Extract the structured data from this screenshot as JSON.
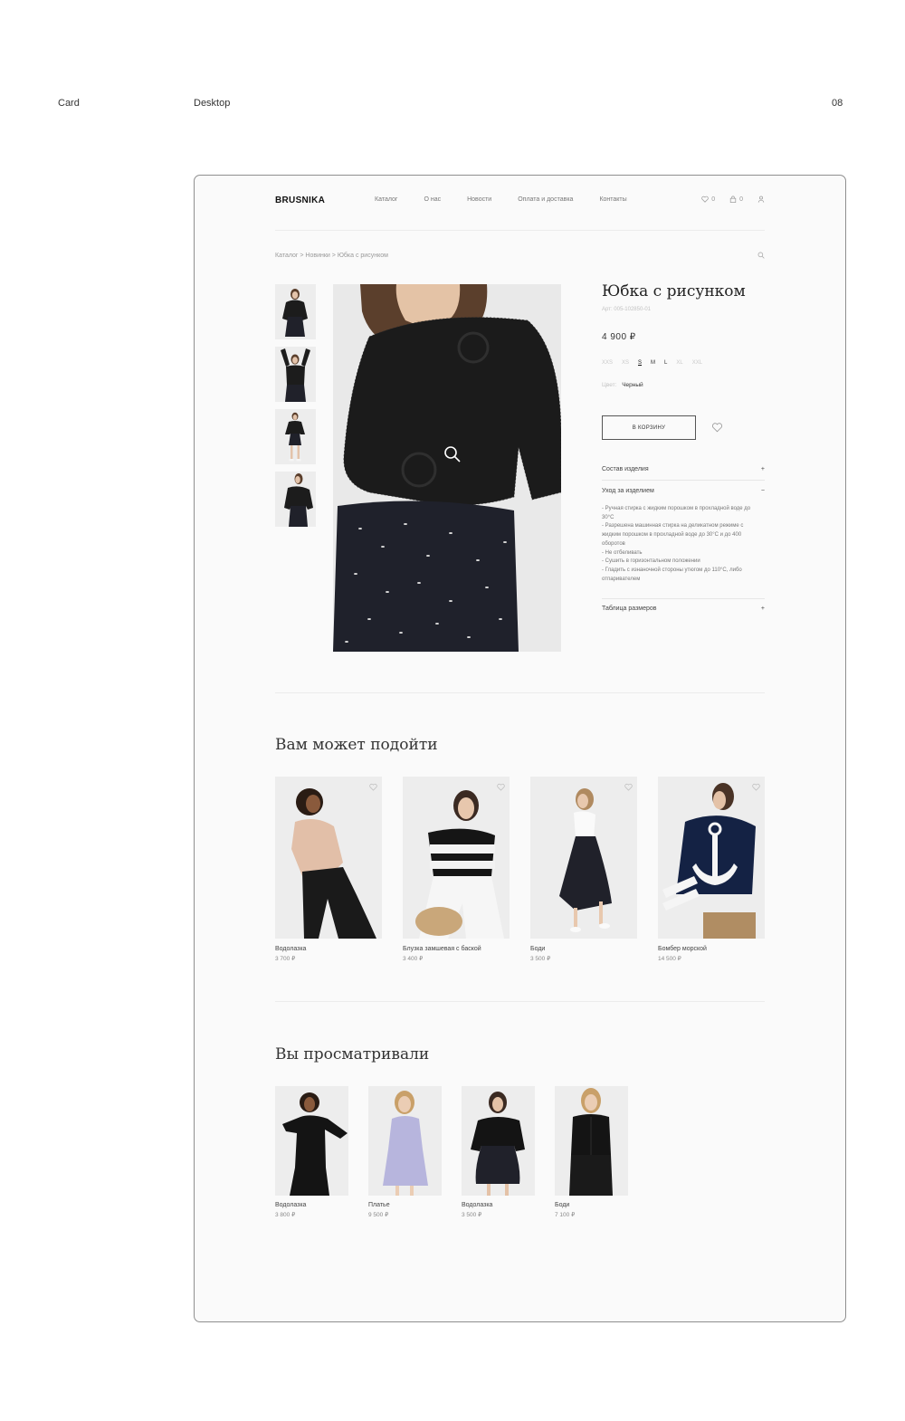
{
  "slide": {
    "section": "Card",
    "device": "Desktop",
    "page_number": "08"
  },
  "header": {
    "logo": "BRUSNIKA",
    "nav": [
      "Каталог",
      "О нас",
      "Новости",
      "Оплата и доставка",
      "Контакты"
    ],
    "favorites_count": "0",
    "cart_count": "0"
  },
  "breadcrumb": "Каталог > Новинки > Юбка с рисунком",
  "product": {
    "title": "Юбка с рисунком",
    "article": "Арт: 005-102850-01",
    "price": "4 900 ₽",
    "sizes": [
      "XXS",
      "XS",
      "S",
      "M",
      "L",
      "XL",
      "XXL"
    ],
    "selected_size": "S",
    "color_label": "Цвет:",
    "color_value": "Черный",
    "cart_button": "В корзину",
    "accordion": {
      "composition": "Состав изделия",
      "composition_toggle": "+",
      "care": "Уход за изделием",
      "care_toggle": "−",
      "care_items": [
        "- Ручная стирка с жидким порошком в прохладной воде до 30°С",
        "- Разрешена машинная стирка на деликатном режиме с жидким порошком в прохладной воде до 30°С и до 400 оборотов",
        "- Не отбеливать",
        "- Сушить в горизонтальном положении",
        "- Гладить с изнаночной стороны утюгом до 110°С, либо отпаривателем"
      ],
      "sizes_table": "Таблица размеров",
      "sizes_table_toggle": "+"
    }
  },
  "recommended": {
    "title": "Вам может подойти",
    "items": [
      {
        "name": "Водолазка",
        "price": "3 700 ₽"
      },
      {
        "name": "Блузка замшевая с баской",
        "price": "3 400 ₽"
      },
      {
        "name": "Боди",
        "price": "3 500 ₽"
      },
      {
        "name": "Бомбер морской",
        "price": "14 500 ₽"
      }
    ]
  },
  "viewed": {
    "title": "Вы просматривали",
    "items": [
      {
        "name": "Водолазка",
        "price": "3 800 ₽"
      },
      {
        "name": "Платье",
        "price": "9 500 ₽"
      },
      {
        "name": "Водолазка",
        "price": "3 500 ₽"
      },
      {
        "name": "Боди",
        "price": "7 100 ₽"
      }
    ]
  },
  "colors": {
    "accent": "#111111",
    "frame_border": "#8f8f8f",
    "background": "#fafafa"
  }
}
